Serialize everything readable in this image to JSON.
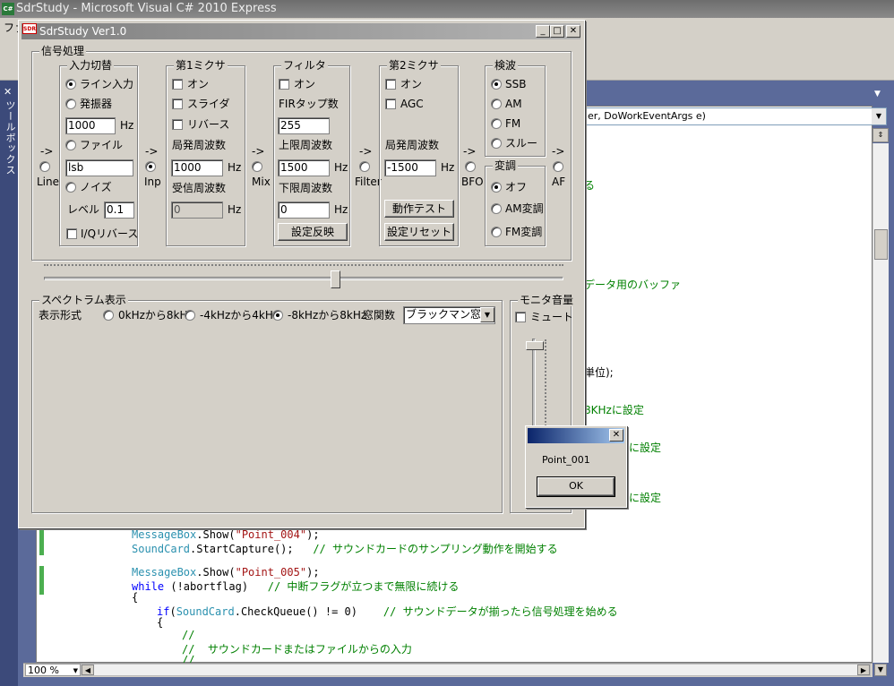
{
  "vs": {
    "title": "SdrStudy - Microsoft Visual C# 2010 Express",
    "menu_partial": "ファ",
    "toolbox_label": "ツールボックス",
    "member_combo": "er, DoWorkEventArgs e)",
    "zoom": "100 %"
  },
  "code": {
    "peek_lines": [
      "る",
      "データ用のバッファ",
      "単位);",
      "8KHzに設定",
      "に設定",
      "に設定"
    ],
    "lines": [
      {
        "cls": "MessageBox",
        "rest": ".Show(",
        "str": "\"Point_004\"",
        "end": ");"
      },
      {
        "cls": "SoundCard",
        "rest": ".StartCapture();   ",
        "cmt": "// サウンドカードのサンプリング動作を開始する"
      },
      {
        "cls": "MessageBox",
        "rest": ".Show(",
        "str": "\"Point_005\"",
        "end": ");"
      },
      {
        "kw": "while",
        "rest": " (!abortflag)   ",
        "cmt": "// 中断フラグが立つまで無限に続ける"
      },
      {
        "plain": "{"
      },
      {
        "kw": "if",
        "rest1": "(",
        "cls": "SoundCard",
        "rest": ".CheckQueue() != 0)    ",
        "cmt": "// サウンドデータが揃ったら信号処理を始める"
      },
      {
        "plain": "{"
      },
      {
        "cmt": "//"
      },
      {
        "cmt": "//  サウンドカードまたはファイルからの入力"
      },
      {
        "cmt": "//"
      }
    ]
  },
  "app": {
    "title": "SdrStudy Ver1.0",
    "icon_text": "SDR",
    "signal_group": "信号処理",
    "input_group": {
      "title": "入力切替",
      "line_in": "ライン入力",
      "oscillator": "発振器",
      "osc_freq": "1000",
      "hz": "Hz",
      "file": "ファイル",
      "file_name": "lsb",
      "noise": "ノイズ",
      "level_label": "レベル",
      "level": "0.1",
      "iq_reverse": "I/Qリバース"
    },
    "mixer1": {
      "title": "第1ミクサ",
      "on": "オン",
      "slider": "スライダ",
      "reverse": "リバース",
      "lo_label": "局発周波数",
      "lo": "1000",
      "rx_label": "受信周波数",
      "rx": "0",
      "hz": "Hz"
    },
    "filter": {
      "title": "フィルタ",
      "on": "オン",
      "taps_label": "FIRタップ数",
      "taps": "255",
      "upper_label": "上限周波数",
      "upper": "1500",
      "lower_label": "下限周波数",
      "lower": "0",
      "hz": "Hz",
      "apply": "設定反映"
    },
    "mixer2": {
      "title": "第2ミクサ",
      "on": "オン",
      "agc": "AGC",
      "lo_label": "局発周波数",
      "lo": "-1500",
      "hz": "Hz",
      "test": "動作テスト",
      "reset": "設定リセット"
    },
    "detect": {
      "title": "検波",
      "ssb": "SSB",
      "am": "AM",
      "fm": "FM",
      "through": "スルー"
    },
    "modulate": {
      "title": "変調",
      "off": "オフ",
      "am": "AM変調",
      "fm": "FM変調"
    },
    "taps": {
      "arrow": "->",
      "line": "Line",
      "inp": "Inp",
      "mix": "Mix",
      "filter": "Filter",
      "bfo": "BFO",
      "af": "AF"
    },
    "spectrum": {
      "title": "スペクトラム表示",
      "format_label": "表示形式",
      "opt1": "0kHzから8kHz",
      "opt2": "-4kHzから4kHz",
      "opt3": "-8kHzから8kHz",
      "window_label": "窓関数",
      "window_value": "ブラックマン窓"
    },
    "monitor": {
      "title": "モニタ音量",
      "mute": "ミュート"
    },
    "slider_position": 0.56,
    "volume_level": 0.98
  },
  "msgbox": {
    "message": "Point_001",
    "ok": "OK"
  }
}
